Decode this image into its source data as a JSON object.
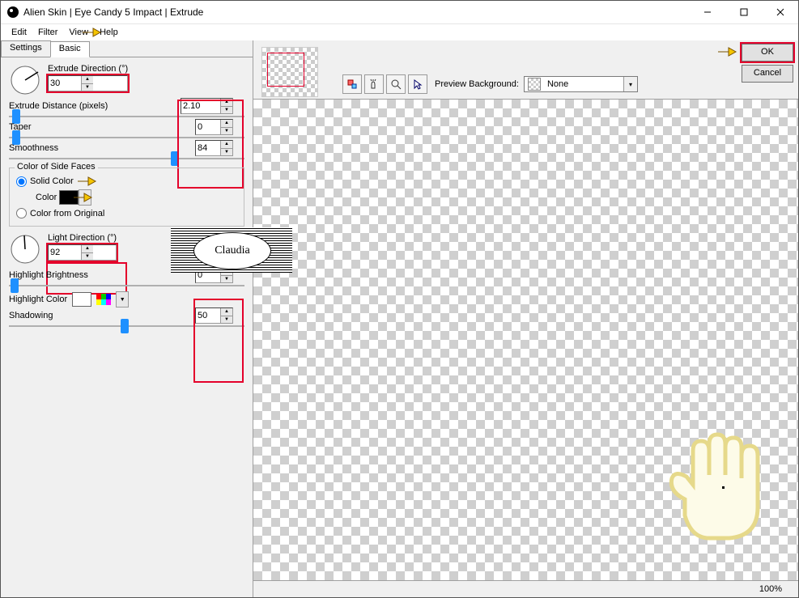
{
  "window": {
    "title": "Alien Skin | Eye Candy 5 Impact | Extrude"
  },
  "menu": {
    "edit": "Edit",
    "filter": "Filter",
    "view": "View",
    "help": "Help"
  },
  "tabs": {
    "settings": "Settings",
    "basic": "Basic"
  },
  "controls": {
    "extrude_direction_label": "Extrude Direction (°)",
    "extrude_direction_value": "30",
    "extrude_distance_label": "Extrude Distance (pixels)",
    "extrude_distance_value": "2.10",
    "taper_label": "Taper",
    "taper_value": "0",
    "smoothness_label": "Smoothness",
    "smoothness_value": "84",
    "color_side_faces_label": "Color of Side Faces",
    "solid_color_label": "Solid Color",
    "color_label": "Color",
    "color_from_original_label": "Color from Original",
    "light_direction_label": "Light Direction (°)",
    "light_direction_value": "92",
    "highlight_brightness_label": "Highlight Brightness",
    "highlight_brightness_value": "0",
    "highlight_color_label": "Highlight Color",
    "shadowing_label": "Shadowing",
    "shadowing_value": "50"
  },
  "preview": {
    "bg_label": "Preview Background:",
    "bg_value": "None"
  },
  "buttons": {
    "ok": "OK",
    "cancel": "Cancel"
  },
  "status": {
    "zoom": "100%"
  },
  "watermark": {
    "text": "Claudia"
  }
}
